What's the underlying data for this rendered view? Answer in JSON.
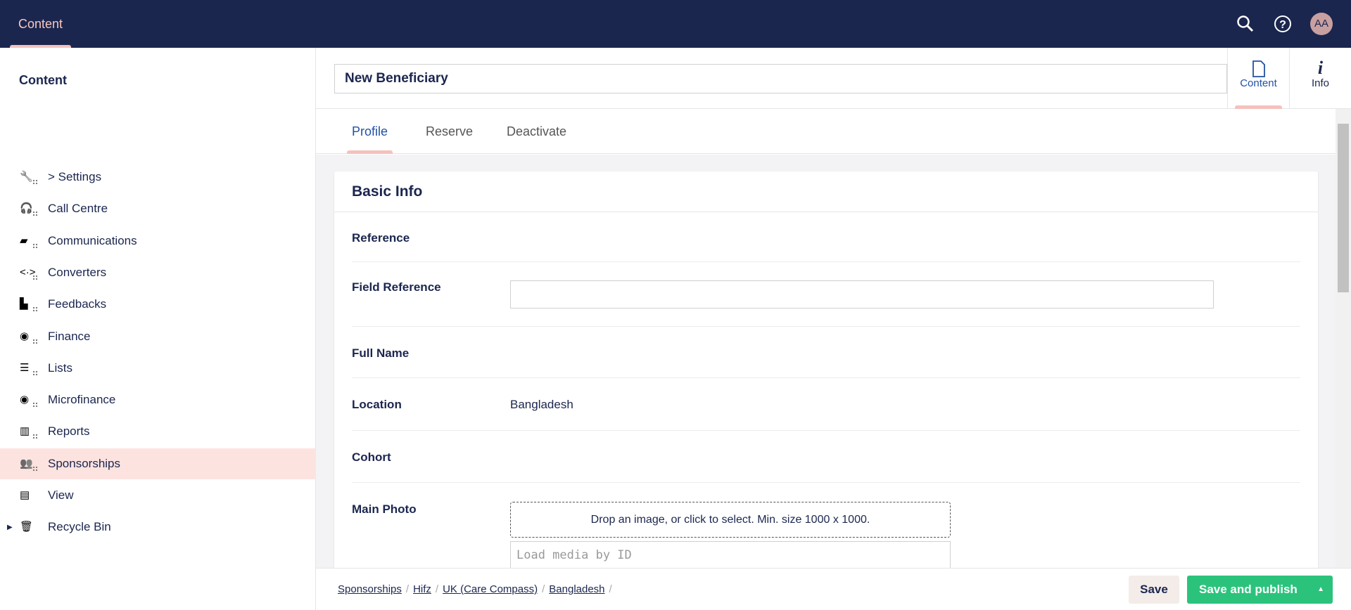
{
  "topbar": {
    "section": "Content",
    "avatar": "AA"
  },
  "sidebar": {
    "title": "Content",
    "items": [
      {
        "label": "> Settings",
        "icon": "wrench-icon"
      },
      {
        "label": "Call Centre",
        "icon": "headset-icon"
      },
      {
        "label": "Communications",
        "icon": "inbox-icon"
      },
      {
        "label": "Converters",
        "icon": "code-icon"
      },
      {
        "label": "Feedbacks",
        "icon": "feedback-icon"
      },
      {
        "label": "Finance",
        "icon": "coins-icon"
      },
      {
        "label": "Lists",
        "icon": "numbered-list-icon"
      },
      {
        "label": "Microfinance",
        "icon": "coin-stack-icon"
      },
      {
        "label": "Reports",
        "icon": "books-icon"
      },
      {
        "label": "Sponsorships",
        "icon": "users-icon",
        "active": true
      },
      {
        "label": "View",
        "icon": "newspaper-icon"
      },
      {
        "label": "Recycle Bin",
        "icon": "trash-icon"
      }
    ]
  },
  "editor": {
    "name": "New Beneficiary",
    "apps": [
      "Content",
      "Info"
    ],
    "tabs": [
      "Profile",
      "Reserve",
      "Deactivate"
    ],
    "card_title": "Basic Info",
    "fields": {
      "reference": "Reference",
      "field_reference": "Field Reference",
      "full_name": "Full Name",
      "location": "Location",
      "location_value": "Bangladesh",
      "cohort": "Cohort",
      "main_photo": "Main Photo",
      "dropzone": "Drop an image, or click to select. Min. size 1000 x 1000.",
      "media_placeholder": "Load media by ID"
    }
  },
  "footer": {
    "breadcrumb": [
      "Sponsorships",
      "Hifz",
      "UK (Care Compass)",
      "Bangladesh"
    ],
    "save": "Save",
    "save_publish": "Save and publish"
  },
  "colors": {
    "topbar": "#1b264f",
    "accent": "#f5c1bc",
    "publish": "#2bc37c",
    "link": "#2152a3"
  }
}
